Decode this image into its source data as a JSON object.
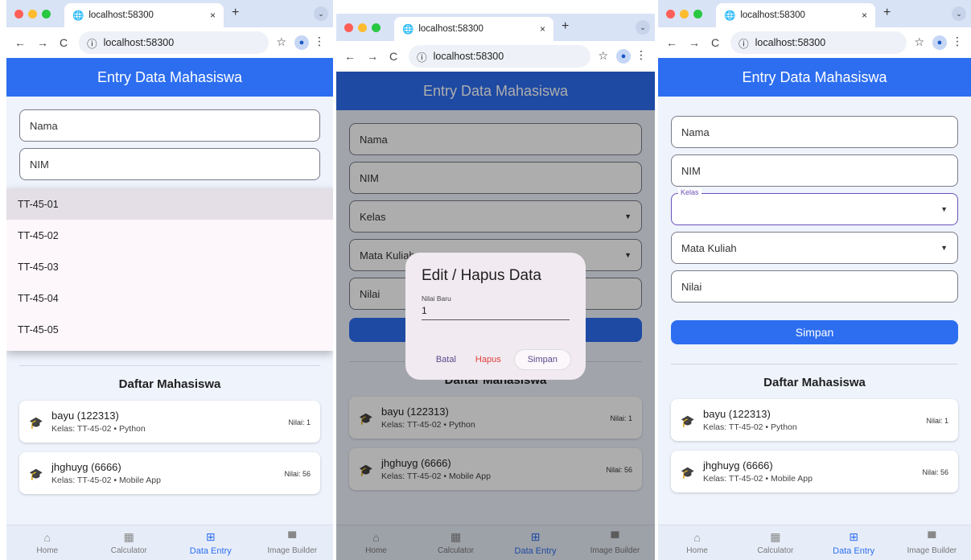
{
  "browser": {
    "tab_title": "localhost:58300",
    "address": "localhost:58300",
    "close_glyph": "×",
    "newtab_glyph": "+",
    "dropdown_glyph": "⌄"
  },
  "app": {
    "title": "Entry Data Mahasiswa",
    "fields": {
      "nama": "Nama",
      "nim": "NIM",
      "kelas": "Kelas",
      "mata_kuliah": "Mata Kuliah",
      "nilai": "Nilai"
    },
    "save_button": "Simpan",
    "list_title": "Daftar Mahasiswa",
    "students": [
      {
        "name": "bayu (122313)",
        "detail": "Kelas: TT-45-02 • Python",
        "score": "Nilai: 1"
      },
      {
        "name": "jhghuyg (6666)",
        "detail": "Kelas: TT-45-02 • Mobile App",
        "score": "Nilai: 56"
      }
    ],
    "nav": [
      "Home",
      "Calculator",
      "Data Entry",
      "Image Builder"
    ],
    "active_nav": "Data Entry"
  },
  "kelas_menu": {
    "options": [
      "TT-45-01",
      "TT-45-02",
      "TT-45-03",
      "TT-45-04",
      "TT-45-05"
    ],
    "highlighted": "TT-45-01"
  },
  "dialog": {
    "title": "Edit / Hapus Data",
    "field_label": "Nilai Baru",
    "field_value": "1",
    "cancel": "Batal",
    "delete": "Hapus",
    "save": "Simpan"
  },
  "colors": {
    "primary": "#2d6ef0",
    "delete": "#e0413a",
    "accent_purple": "#6a52b8"
  }
}
